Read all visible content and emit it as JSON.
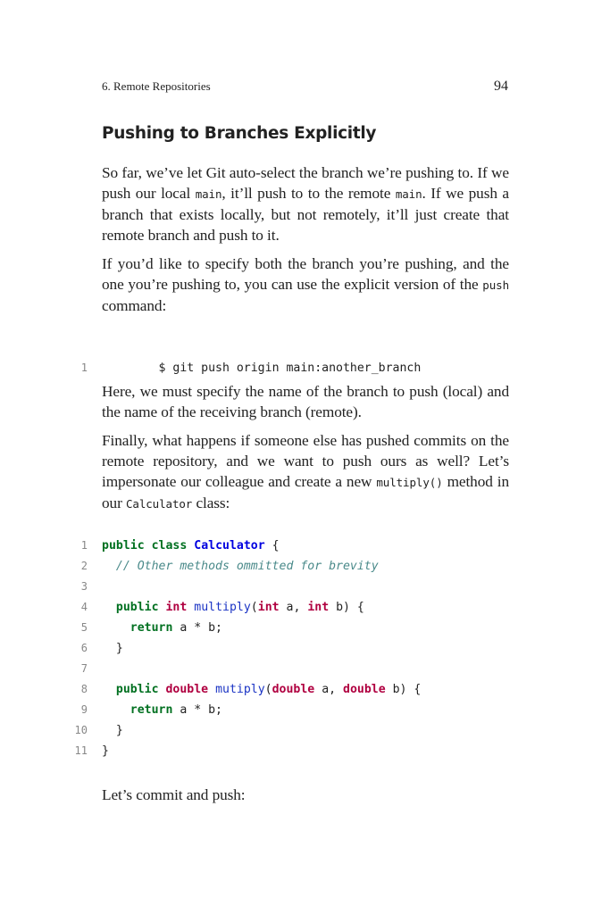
{
  "header": {
    "chapter": "6. Remote Repositories",
    "page_number": "94"
  },
  "section": {
    "title": "Pushing to Branches Explicitly"
  },
  "paragraphs": {
    "p1_a": "So far, we’ve let Git auto-select the branch we’re pushing to. If we push our local ",
    "p1_code1": "main",
    "p1_b": ", it’ll push to to the remote ",
    "p1_code2": "main",
    "p1_c": ". If we push a branch that exists locally, but not remotely, it’ll just create that remote branch and push to it.",
    "p2_a": "If you’d like to specify both the branch you’re pushing, and the one you’re pushing to, you can use the explicit version of the ",
    "p2_code": "push",
    "p2_b": " command:",
    "p3": "Here, we must specify the name of the branch to push (local) and the name of the receiving branch (remote).",
    "p4_a": "Finally, what happens if someone else has pushed commits on the remote repository, and we want to push ours as well? Let’s impersonate our colleague and create a new ",
    "p4_code1": "multiply()",
    "p4_b": " method in our ",
    "p4_code2": "Calculator",
    "p4_c": " class:",
    "p5": "Let’s commit and push:"
  },
  "code1": {
    "lines": [
      {
        "number": "1",
        "text": "$ git push origin main:another_branch"
      }
    ]
  },
  "code2": {
    "numbers": [
      "1",
      "2",
      "3",
      "4",
      "5",
      "6",
      "7",
      "8",
      "9",
      "10",
      "11"
    ],
    "tokens": {
      "l1_public": "public",
      "l1_class": "class",
      "l1_name": "Calculator",
      "l1_brace": " {",
      "l2_comment": "// Other methods ommitted for brevity",
      "l4_public": "public",
      "l4_int": "int",
      "l4_fn": "multiply",
      "l4_paren": "(",
      "l4_int2": "int",
      "l4_a": " a, ",
      "l4_int3": "int",
      "l4_b": " b) {",
      "l5_return": "return",
      "l5_expr": " a * b;",
      "l6_close": "}",
      "l8_public": "public",
      "l8_double": "double",
      "l8_fn": "mutiply",
      "l8_paren": "(",
      "l8_double2": "double",
      "l8_a": " a, ",
      "l8_double3": "double",
      "l8_b": " b) {",
      "l9_return": "return",
      "l9_expr": " a * b;",
      "l10_close": "}",
      "l11_close": "}"
    }
  },
  "colors": {
    "keyword": "#007020",
    "type_keyword": "#b00040",
    "class_name": "#0000e0",
    "function_name": "#1a33c4",
    "comment": "#4a8a8a"
  }
}
